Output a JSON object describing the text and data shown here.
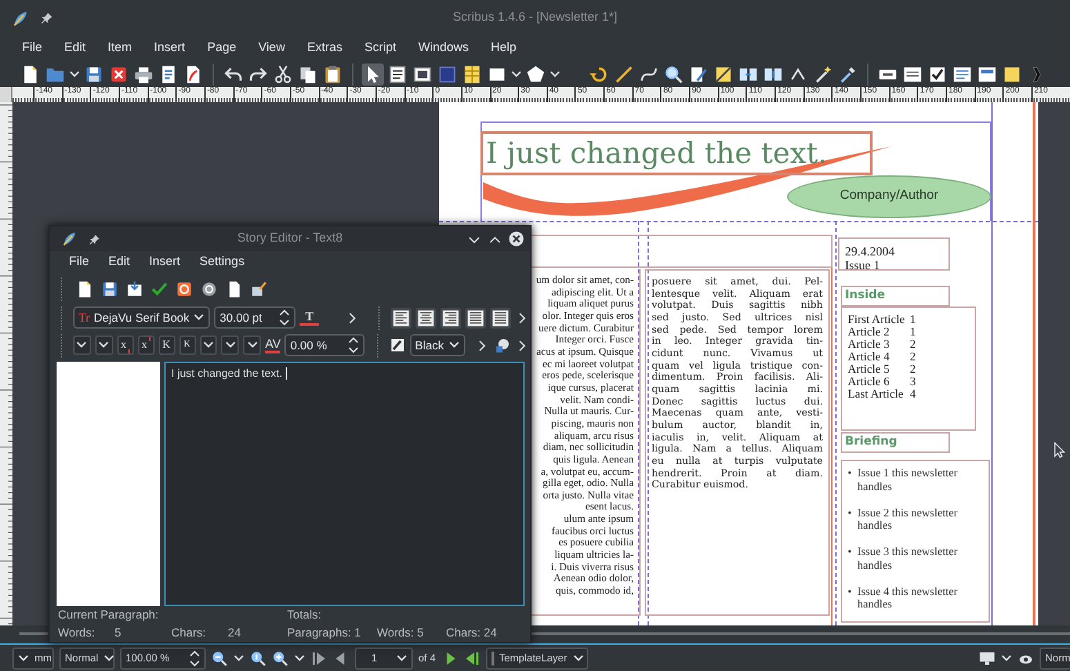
{
  "window": {
    "title": "Scribus 1.4.6 - [Newsletter 1*]"
  },
  "menu": [
    "File",
    "Edit",
    "Item",
    "Insert",
    "Page",
    "View",
    "Extras",
    "Script",
    "Windows",
    "Help"
  ],
  "ruler": {
    "labels": [
      "-140",
      "-130",
      "-120",
      "-110",
      "-100",
      "-90",
      "-80",
      "-70",
      "-60",
      "-50",
      "-40",
      "-30",
      "-20",
      "-10",
      "0",
      "10",
      "20",
      "30",
      "40",
      "50",
      "60",
      "70",
      "80",
      "90",
      "100",
      "110",
      "120",
      "130",
      "140",
      "150",
      "160",
      "170",
      "180",
      "190",
      "200",
      "210"
    ]
  },
  "page": {
    "headline": "I just changed the text.",
    "ellipse": "Company/Author",
    "column_1": [
      "um dolor sit amet, con-",
      "adipiscing elit. Ut a",
      "liquam aliquet purus",
      "olor. Integer quis eros",
      "uere dictum. Curabitur",
      "Integer orci. Fusce",
      "acus at ipsum. Quisque",
      "ec mi laoreet volutpat",
      "eros pede, scelerisque",
      "ique cursus, placerat",
      "velit. Nam condi-",
      "Nulla ut mauris. Cur-",
      "piscing, mauris non",
      "aliquam, arcu risus",
      "diam, nec sollicitudin",
      "quis ligula. Aenean",
      "a, volutpat eu, accum-",
      "gilla eget, odio. Nulla",
      "orta justo. Nulla vitae",
      "esent lacus.",
      "ulum ante ipsum",
      "faucibus orci luctus",
      "es posuere cubilia",
      "liquam ultricies la-",
      "i. Duis viverra risus",
      "Aenean odio dolor,",
      "quis, commodo id,"
    ],
    "column_2": [
      "posuere sit amet, dui. Pel-",
      "lentesque velit. Aliquam erat",
      "volutpat. Duis sagittis nibh",
      "sed justo. Sed ultrices nisl",
      "sed pede. Sed tempor lorem",
      "in leo. Integer gravida tin-",
      "cidunt nunc. Vivamus ut",
      "quam vel ligula tristique con-",
      "dimentum. Proin facilisis. Ali-",
      "quam sagittis lacinia mi.",
      "Donec sagittis luctus dui.",
      "Maecenas quam ante, vesti-",
      "bulum auctor, blandit in,",
      "iaculis in, velit. Aliquam at",
      "ligula. Nam a tellus. Aliquam",
      "eu nulla at turpis vulputate",
      "hendrerit. Proin at diam.",
      "Curabitur euismod."
    ],
    "date_box": [
      "29.4.2004",
      "Issue 1"
    ],
    "inside": {
      "heading": "Inside",
      "rows": [
        {
          "name": "First Article",
          "page": "1"
        },
        {
          "name": "Article 2",
          "page": "1"
        },
        {
          "name": "Article 3",
          "page": "2"
        },
        {
          "name": "Article 4",
          "page": "2"
        },
        {
          "name": "Article 5",
          "page": "2"
        },
        {
          "name": "Article 6",
          "page": "3"
        },
        {
          "name": "Last Article",
          "page": "4"
        }
      ]
    },
    "briefing": {
      "heading": "Briefing",
      "items": [
        {
          "bullet": "•",
          "text": "Issue 1 this newsletter handles"
        },
        {
          "bullet": "•",
          "text": "Issue 2 this newsletter handles"
        },
        {
          "bullet": "•",
          "text": "Issue 3 this newsletter handles"
        },
        {
          "bullet": "•",
          "text": "Issue 4 this newsletter handles"
        }
      ]
    }
  },
  "story_editor": {
    "title": "Story Editor - Text8",
    "menu": [
      "File",
      "Edit",
      "Insert",
      "Settings"
    ],
    "font_icon": "Tr",
    "font": "DejaVu Serif Book",
    "size": "30.00 pt",
    "stroke_icon": "T",
    "format_buttons": [
      {
        "kind": "subscript",
        "label": "x"
      },
      {
        "kind": "superscript",
        "label": "x"
      },
      {
        "kind": "caps",
        "label": "K"
      },
      {
        "kind": "smallcaps",
        "label": "K"
      }
    ],
    "tracking_icon": "AV",
    "tracking": "0.00 %",
    "color_name": "Black",
    "text": "I just changed the text.",
    "status": {
      "current_label": "Current Paragraph:",
      "totals_label": "Totals:",
      "words_label": "Words:",
      "words": "5",
      "chars_label": "Chars:",
      "chars": "24",
      "paragraphs": "Paragraphs: 1",
      "total_words": "Words: 5",
      "total_chars": "Chars: 24"
    }
  },
  "status_bar": {
    "unit": "mm",
    "mode": "Normal",
    "zoom": "100.00 %",
    "page": "1",
    "page_count": "of 4",
    "layer": "TemplateLayer",
    "preview_mode": "Norm"
  }
}
